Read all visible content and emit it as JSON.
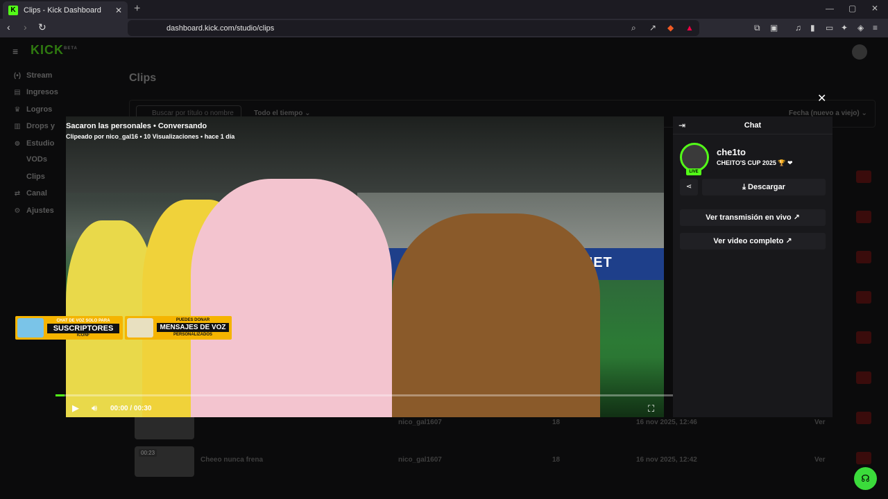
{
  "browser": {
    "tab_title": "Clips - Kick Dashboard",
    "tab_favicon": "K",
    "url": "dashboard.kick.com/studio/clips"
  },
  "app": {
    "logo": "KICK",
    "logo_badge": "BETA",
    "page_title": "Clips",
    "accent": "#53fc18"
  },
  "sidebar": {
    "items": [
      {
        "label": "Stream",
        "icon": "stream-icon"
      },
      {
        "label": "Ingresos",
        "icon": "money-icon"
      },
      {
        "label": "Logros",
        "icon": "trophy-icon"
      },
      {
        "label": "Drops y",
        "icon": "drops-icon"
      },
      {
        "label": "Estudio",
        "icon": "studio-icon"
      }
    ],
    "subitems": [
      "VODs",
      "Clips"
    ],
    "items2": [
      {
        "label": "Canal",
        "icon": "channel-icon"
      },
      {
        "label": "Ajustes",
        "icon": "settings-icon"
      }
    ]
  },
  "filters": {
    "search_placeholder": "Buscar por título o nombre",
    "period": "Todo el tiempo",
    "sort": "Fecha (nuevo a viejo)"
  },
  "rows": [
    {
      "duration": "",
      "title": "",
      "author": "nico_gal1607",
      "views": "18",
      "date": "16 nov 2025, 12:46",
      "action": "Ver"
    },
    {
      "duration": "00:23",
      "title": "Cheeo nunca frena",
      "author": "nico_gal1607",
      "views": "18",
      "date": "16 nov 2025, 12:42",
      "action": "Ver"
    }
  ],
  "player": {
    "title": "Sacaron las personales • Conversando",
    "meta": "Clipeado por nico_gal16 • 10 Visualizaciones • hace 1 día",
    "time": "00:00 / 00:30",
    "progress": 0.015,
    "adboard": "TELECOMNET",
    "promo1": {
      "top": "CHAT DE VOZ SOLO PARA",
      "main": "SUSCRIPTORES",
      "bottom": "ICONF"
    },
    "promo2": {
      "top": "PUEDES DONAR",
      "main": "MENSAJES DE VOZ",
      "bottom": "PERSONALIZADOS"
    }
  },
  "chat": {
    "header": "Chat",
    "channel_name": "che1to",
    "channel_sub": "CHEITO'S CUP 2025 🏆 ❤",
    "live": "LIVE",
    "download": "Descargar",
    "watch_live": "Ver transmisión en vivo",
    "watch_full": "Ver video completo"
  }
}
